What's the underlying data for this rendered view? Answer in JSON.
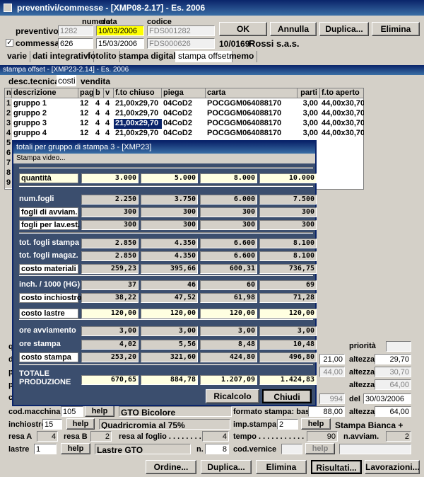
{
  "window": {
    "title": "preventivi/commesse - [XMP08-2.17] - Es. 2006"
  },
  "header": {
    "col_numero": "numero",
    "col_data": "data",
    "col_codice": "codice",
    "preventivo_label": "preventivo",
    "preventivo_numero": "1282",
    "preventivo_data": "10/03/2006",
    "preventivo_codice": "FDS001282",
    "commessa_label": "commessa",
    "commessa_checked": "✓",
    "commessa_numero": "626",
    "commessa_data": "15/03/2006",
    "commessa_codice": "FDS000626",
    "cliente_code": "10/0169",
    "cliente_name": "Rossi s.a.s."
  },
  "buttons": {
    "ok": "OK",
    "annulla": "Annulla",
    "duplica": "Duplica...",
    "elimina": "Elimina"
  },
  "tabs": [
    "varie",
    "dati integrativi",
    "fotolito",
    "stampa digitale",
    "stampa offset",
    "memo"
  ],
  "subwindow": {
    "title": "stampa offset - [XMP23-2.14] - Es. 2006",
    "tabs": [
      "desc.tecnica",
      "costi",
      "vendita"
    ]
  },
  "grid": {
    "headers": [
      "n",
      "descrizione",
      "pag",
      "b",
      "v",
      "f.to chiuso",
      "piega",
      "carta",
      "parti",
      "f.to aperto"
    ],
    "rows": [
      [
        "1",
        "gruppo 1",
        "12",
        "4",
        "4",
        "21,00x29,70",
        "04CoD2",
        "POCGGM064088170",
        "3,00",
        "44,00x30,70"
      ],
      [
        "2",
        "gruppo 2",
        "12",
        "4",
        "4",
        "21,00x29,70",
        "04CoD2",
        "POCGGM064088170",
        "3,00",
        "44,00x30,70"
      ],
      [
        "3",
        "gruppo 3",
        "12",
        "4",
        "4",
        "21,00x29,70",
        "04CoD2",
        "POCGGM064088170",
        "3,00",
        "44,00x30,70"
      ],
      [
        "4",
        "gruppo 4",
        "12",
        "4",
        "4",
        "21,00x29,70",
        "04CoD2",
        "POCGGM064088170",
        "3,00",
        "44,00x30,70"
      ]
    ],
    "extra_rows": [
      "5",
      "6",
      "7",
      "8",
      "9"
    ]
  },
  "modal": {
    "title": "totali per gruppo di stampa 3 - [XMP23]",
    "menu": "Stampa video...",
    "quantita": {
      "label": "quantità",
      "values": [
        "3.000",
        "5.000",
        "8.000",
        "10.000"
      ]
    },
    "rows": [
      {
        "label": "num.fogli",
        "values": [
          "2.250",
          "3.750",
          "6.000",
          "7.500"
        ]
      },
      {
        "label": "fogli di avviam.",
        "values": [
          "300",
          "300",
          "300",
          "300"
        ]
      },
      {
        "label": "fogli per lav.est.",
        "values": [
          "300",
          "300",
          "300",
          "300"
        ]
      },
      {
        "label": "tot. fogli stampa",
        "values": [
          "2.850",
          "4.350",
          "6.600",
          "8.100"
        ]
      },
      {
        "label": "tot. fogli magaz.",
        "values": [
          "2.850",
          "4.350",
          "6.600",
          "8.100"
        ]
      },
      {
        "label": "costo materiali",
        "values": [
          "259,23",
          "395,66",
          "600,31",
          "736,75"
        ]
      },
      {
        "label": "inch. / 1000 (HG)",
        "values": [
          "37",
          "46",
          "60",
          "69"
        ]
      },
      {
        "label": "costo inchiostro",
        "values": [
          "38,22",
          "47,52",
          "61,98",
          "71,28"
        ]
      },
      {
        "label": "costo lastre",
        "values": [
          "120,00",
          "120,00",
          "120,00",
          "120,00"
        ]
      },
      {
        "label": "ore avviamento",
        "values": [
          "3,00",
          "3,00",
          "3,00",
          "3,00"
        ]
      },
      {
        "label": "ore stampa",
        "values": [
          "4,02",
          "5,56",
          "8,48",
          "10,48"
        ]
      },
      {
        "label": "costo stampa",
        "values": [
          "253,20",
          "321,60",
          "424,80",
          "496,80"
        ]
      }
    ],
    "totale": {
      "label1": "TOTALE",
      "label2": "PRODUZIONE",
      "values": [
        "670,65",
        "884,78",
        "1.207,09",
        "1.424,83"
      ]
    },
    "ricalcolo": "Ricalcolo",
    "chiudi": "Chiudi"
  },
  "right": {
    "priorita": "priorità",
    "v21": "21,00",
    "altezza": "altezza",
    "v2970": "29,70",
    "v44": "44,00",
    "v3070": "30,70",
    "v6400d": "64,00",
    "v994": "994",
    "del": "del",
    "date": "30/03/2006",
    "v88": "88,00",
    "v6400": "64,00",
    "formato": "formato stampa: base"
  },
  "bottom": {
    "cod_macchina": "cod.macchina",
    "macchina_code": "105",
    "help": "help",
    "macchina_name": "GTO Bicolore",
    "inchiostro": "inchiostro",
    "inchiostro_code": "15",
    "inchiostro_name": "Quadricromia al 75%",
    "imp_stampa": "imp.stampa",
    "imp_val": "2",
    "stampa_bianca": "Stampa Bianca +",
    "resa_a": "resa A",
    "resa_a_val": "4",
    "resa_b": "resa B",
    "resa_b_val": "2",
    "resa_foglio": "resa al foglio . . . . . . . .",
    "resa_foglio_val": "4",
    "tempo": "tempo . . . . . . . . . . .",
    "tempo_val": "90",
    "n_avviam": "n.avviam.",
    "n_avviam_val": "2",
    "lastre": "lastre",
    "lastre_code": "1",
    "lastre_name": "Lastre GTO",
    "n": "n.",
    "n_val": "8",
    "cod_vernice": "cod.vernice",
    "left_letters": [
      "q",
      "d",
      "p",
      "p",
      "c"
    ]
  },
  "footer": {
    "ordine": "Ordine...",
    "duplica": "Duplica...",
    "elimina": "Elimina",
    "risultati": "Risultati...",
    "lavorazioni": "Lavorazioni..."
  }
}
